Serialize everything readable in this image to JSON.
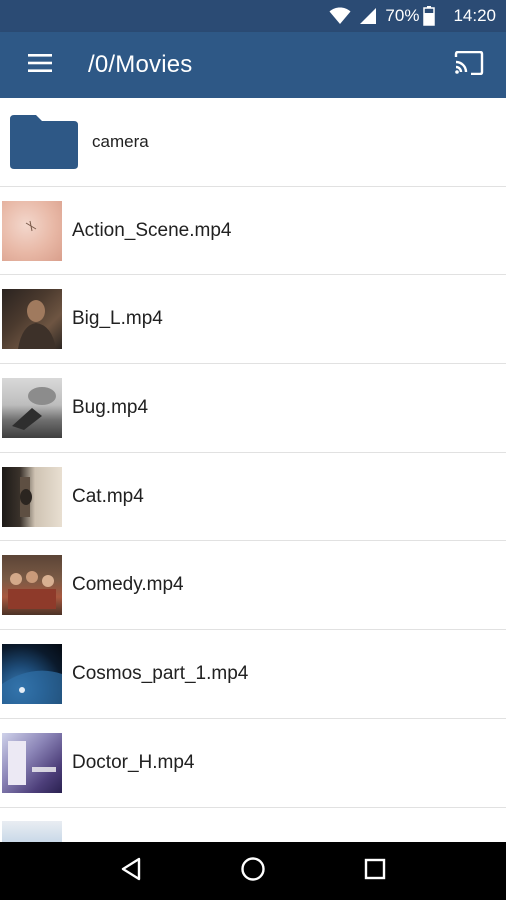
{
  "status_bar": {
    "battery_percent": "70%",
    "time": "14:20",
    "icons": [
      "wifi-icon",
      "cellular-signal-icon",
      "battery-icon"
    ]
  },
  "app_bar": {
    "title": "/0/Movies",
    "menu_icon": "hamburger-menu-icon",
    "cast_icon": "cast-icon",
    "background": "#2e5886"
  },
  "folders": [
    {
      "name": "camera",
      "icon": "folder-icon",
      "color": "#2e5886"
    }
  ],
  "files": [
    {
      "name": "Action_Scene.mp4"
    },
    {
      "name": "Big_L.mp4"
    },
    {
      "name": "Bug.mp4"
    },
    {
      "name": "Cat.mp4"
    },
    {
      "name": "Comedy.mp4"
    },
    {
      "name": "Cosmos_part_1.mp4"
    },
    {
      "name": "Doctor_H.mp4"
    },
    {
      "name": ""
    }
  ],
  "nav_bar": {
    "buttons": [
      "back-icon",
      "home-icon",
      "recents-icon"
    ]
  }
}
